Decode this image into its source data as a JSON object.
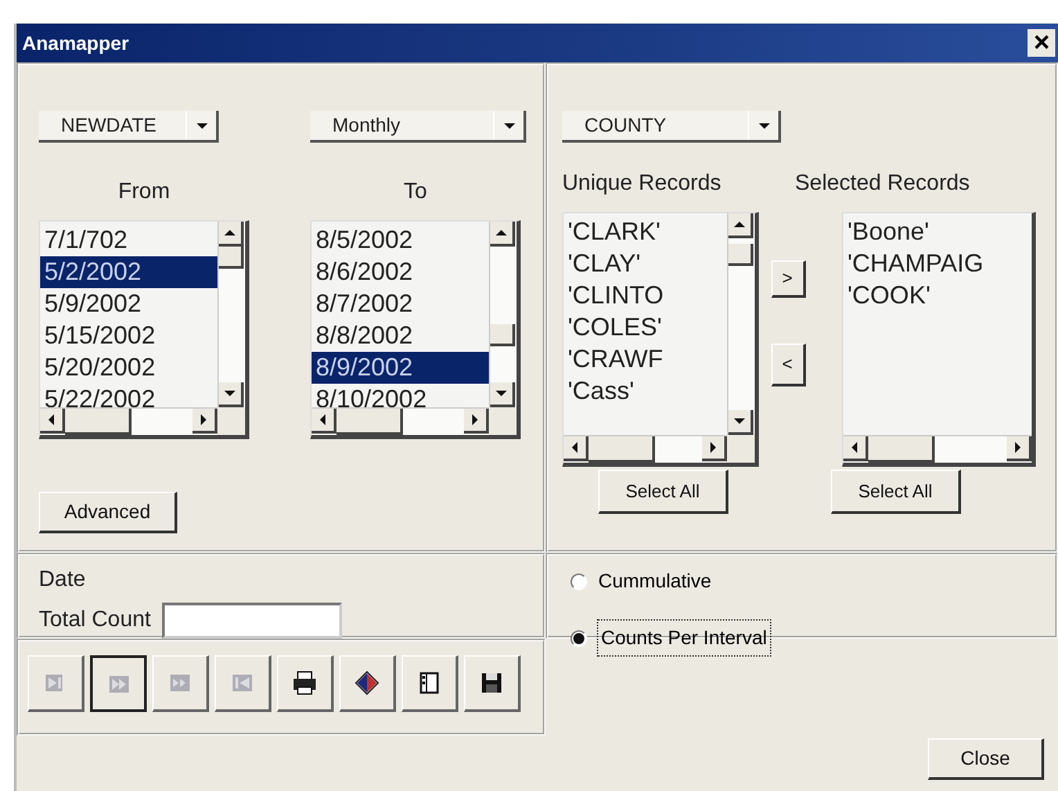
{
  "window": {
    "title": "Anamapper",
    "close_glyph": "×"
  },
  "date_panel": {
    "field_dropdown": {
      "value": "NEWDATE"
    },
    "interval_dropdown": {
      "value": "Monthly"
    },
    "from": {
      "label": "From",
      "items": [
        {
          "text": "7/1/702",
          "selected": false
        },
        {
          "text": "5/2/2002",
          "selected": true
        },
        {
          "text": "5/9/2002",
          "selected": false
        },
        {
          "text": "5/15/2002",
          "selected": false
        },
        {
          "text": "5/20/2002",
          "selected": false
        },
        {
          "text": "5/22/2002",
          "selected": false
        }
      ]
    },
    "to": {
      "label": "To",
      "items": [
        {
          "text": "8/5/2002",
          "selected": false
        },
        {
          "text": "8/6/2002",
          "selected": false
        },
        {
          "text": "8/7/2002",
          "selected": false
        },
        {
          "text": "8/8/2002",
          "selected": false
        },
        {
          "text": "8/9/2002",
          "selected": true
        },
        {
          "text": "8/10/2002",
          "selected": false
        }
      ]
    },
    "advanced_button": "Advanced"
  },
  "records_panel": {
    "field_dropdown": {
      "value": "COUNTY"
    },
    "unique": {
      "label": "Unique Records",
      "select_all": "Select All",
      "items": [
        {
          "text": "'CLARK'",
          "selected": false
        },
        {
          "text": "'CLAY'",
          "selected": false
        },
        {
          "text": "'CLINTO",
          "selected": false
        },
        {
          "text": "'COLES'",
          "selected": false
        },
        {
          "text": "'CRAWF",
          "selected": false
        },
        {
          "text": "'Cass'",
          "selected": false
        }
      ]
    },
    "add_button": ">",
    "remove_button": "<",
    "selected": {
      "label": "Selected Records",
      "select_all": "Select All",
      "items": [
        {
          "text": "'Boone'",
          "selected": false
        },
        {
          "text": "'CHAMPAIG",
          "selected": false
        },
        {
          "text": "'COOK'",
          "selected": false
        }
      ]
    }
  },
  "summary": {
    "date_label": "Date",
    "total_count_label": "Total Count"
  },
  "mode_options": [
    {
      "label": "Cummulative",
      "selected": false
    },
    {
      "label": "Counts Per Interval",
      "selected": true
    }
  ],
  "toolbar": [
    {
      "kind": "next-end",
      "disabled": true,
      "pressed": false
    },
    {
      "kind": "forward",
      "disabled": true,
      "pressed": true
    },
    {
      "kind": "fast-forward",
      "disabled": true,
      "pressed": false
    },
    {
      "kind": "start",
      "disabled": true,
      "pressed": false
    },
    {
      "kind": "print",
      "disabled": false,
      "pressed": false
    },
    {
      "kind": "diamond",
      "disabled": false,
      "pressed": false
    },
    {
      "kind": "panel",
      "disabled": false,
      "pressed": false
    },
    {
      "kind": "save",
      "disabled": false,
      "pressed": false
    }
  ],
  "close_button": "Close"
}
